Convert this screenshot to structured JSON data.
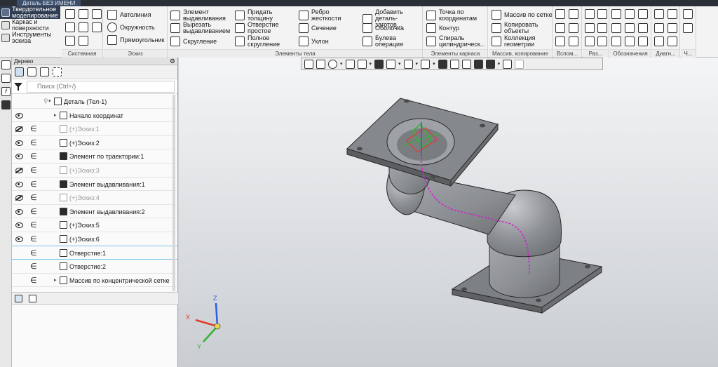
{
  "window": {
    "tab_title": "Деталь БЕЗ ИМЕНИ"
  },
  "modes": [
    {
      "label": "Твердотельное моделирование",
      "icon": "solid-modeling-icon",
      "active": true
    },
    {
      "label": "Каркас и поверхности",
      "icon": "wireframe-icon",
      "active": false
    },
    {
      "label": "Инструменты эскиза",
      "icon": "sketch-tools-icon",
      "active": false
    }
  ],
  "ribbon": {
    "system": {
      "label": "Системная"
    },
    "sketch": {
      "label": "Эскиз",
      "autoline": "Автолиния",
      "circle": "Окружность",
      "rectangle": "Прямоугольник"
    },
    "body": {
      "label": "Элементы тела",
      "extrude": "Элемент выдавливания",
      "cut_extrude": "Вырезать выдавливанием",
      "fillet": "Скругление",
      "shell_thickness": "Придать толщину",
      "simple_hole": "Отверстие простое",
      "full_fillet": "Полное скругление",
      "rib": "Ребро жесткости",
      "section": "Сечение",
      "draft": "Уклон",
      "add_blank": "Добавить деталь-заготов...",
      "shell": "Оболочка",
      "boolean": "Булева операция"
    },
    "frame": {
      "label": "Элементы каркаса",
      "point_by_coords": "Точка по координатам",
      "contour": "Контур",
      "cyl_spiral": "Спираль цилиндрическ..."
    },
    "array": {
      "label": "Массив, копирование",
      "grid_array": "Массив по сетке",
      "copy_objects": "Копировать объекты",
      "geometry_collection": "Коллекция геометрии"
    },
    "aux_label": "Вспом...",
    "sections_label": "Раз...",
    "notation_label": "Обозначения",
    "diagnostics_label": "Диагн...",
    "more_label": "Ч..."
  },
  "panel": {
    "title": "Дерево",
    "search_placeholder": "Поиск (Ctrl+/)"
  },
  "tree": [
    {
      "label": "Деталь (Тел-1)",
      "eye": "none",
      "inc": false,
      "icon": "part-icon",
      "dim": false,
      "indent": 1,
      "arrow": "▾"
    },
    {
      "label": "Начало координат",
      "eye": "on",
      "inc": false,
      "icon": "origin-icon",
      "dim": false,
      "indent": 2,
      "arrow": "▸"
    },
    {
      "label": "(+)Эскиз:1",
      "eye": "off",
      "inc": true,
      "icon": "sketch-icon",
      "dim": true,
      "indent": 2,
      "arrow": ""
    },
    {
      "label": "(+)Эскиз:2",
      "eye": "on",
      "inc": true,
      "icon": "sketch-icon",
      "dim": false,
      "indent": 2,
      "arrow": ""
    },
    {
      "label": "Элемент по траектории:1",
      "eye": "on",
      "inc": true,
      "icon": "sweep-icon",
      "dim": false,
      "indent": 2,
      "arrow": ""
    },
    {
      "label": "(+)Эскиз:3",
      "eye": "off",
      "inc": true,
      "icon": "sketch-icon",
      "dim": true,
      "indent": 2,
      "arrow": ""
    },
    {
      "label": "Элемент выдавливания:1",
      "eye": "on",
      "inc": true,
      "icon": "extrude-icon",
      "dim": false,
      "indent": 2,
      "arrow": ""
    },
    {
      "label": "(+)Эскиз:4",
      "eye": "off",
      "inc": true,
      "icon": "sketch-icon",
      "dim": true,
      "indent": 2,
      "arrow": ""
    },
    {
      "label": "Элемент выдавливания:2",
      "eye": "on",
      "inc": true,
      "icon": "extrude-icon",
      "dim": false,
      "indent": 2,
      "arrow": ""
    },
    {
      "label": "(+)Эскиз:5",
      "eye": "on",
      "inc": true,
      "icon": "sketch-icon",
      "dim": false,
      "indent": 2,
      "arrow": ""
    },
    {
      "label": "(+)Эскиз:6",
      "eye": "on",
      "inc": true,
      "icon": "sketch-icon",
      "dim": false,
      "indent": 2,
      "arrow": ""
    },
    {
      "label": "Отверстие:1",
      "eye": "none",
      "inc": true,
      "icon": "hole-icon",
      "dim": false,
      "indent": 2,
      "arrow": ""
    },
    {
      "label": "Отверстие:2",
      "eye": "none",
      "inc": true,
      "icon": "hole-icon",
      "dim": false,
      "indent": 2,
      "arrow": ""
    },
    {
      "label": "Массив по концентрической сетке",
      "eye": "none",
      "inc": true,
      "icon": "concentric-array-icon",
      "dim": false,
      "indent": 2,
      "arrow": "▸"
    }
  ],
  "triad": {
    "x": "X",
    "y": "Y",
    "z": "Z"
  },
  "colors": {
    "accent_dark": "#2f3d52",
    "model_gray": "#8f9296",
    "trajectory": "#d01fd0",
    "axis_x": "#e23a2e",
    "axis_y": "#2fb52f",
    "axis_z": "#2f5de2"
  }
}
